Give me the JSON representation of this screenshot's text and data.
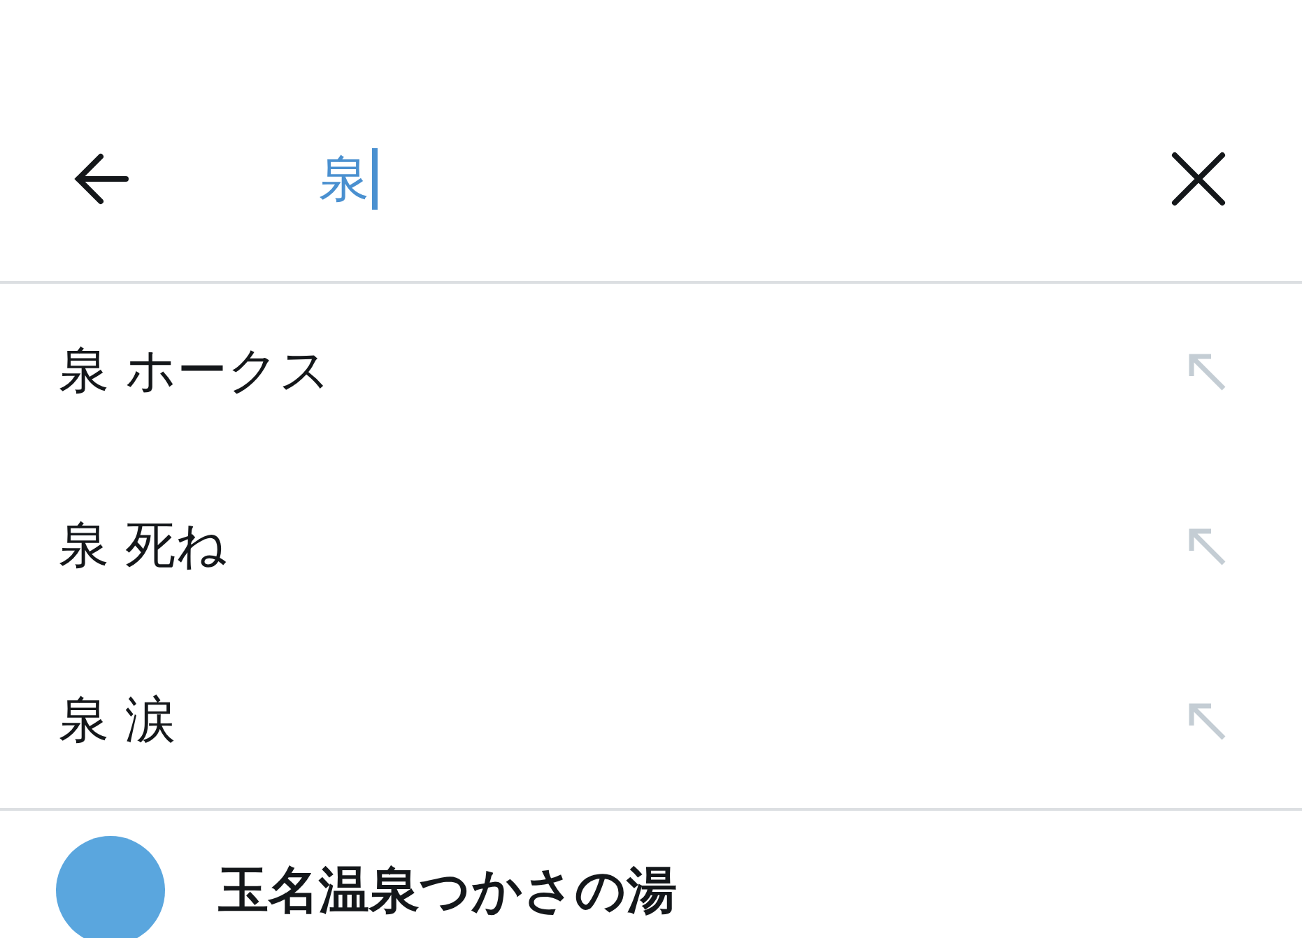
{
  "search": {
    "value": "泉",
    "focused": true
  },
  "suggestions": [
    {
      "text": "泉 ホークス"
    },
    {
      "text": "泉 死ね"
    },
    {
      "text": "泉 涙"
    }
  ],
  "accounts": [
    {
      "name": "玉名温泉つかさの湯"
    }
  ]
}
